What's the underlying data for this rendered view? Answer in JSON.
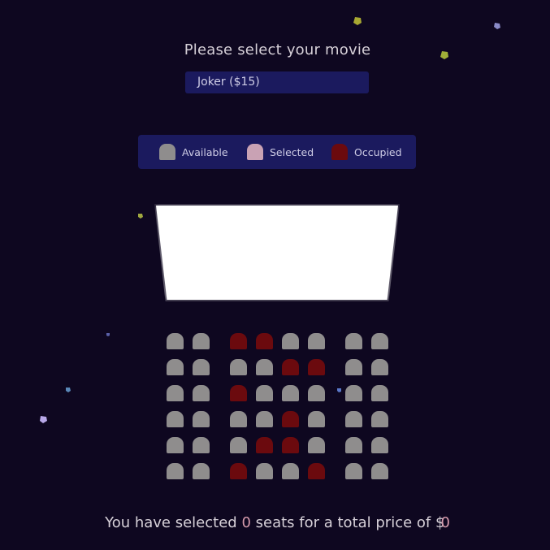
{
  "movie": {
    "label": "Please select your movie",
    "selected": "Joker ($15)"
  },
  "legend": [
    {
      "label": "Available",
      "state": "available"
    },
    {
      "label": "Selected",
      "state": "selected"
    },
    {
      "label": "Occupied",
      "state": "occupied"
    }
  ],
  "seats": [
    [
      "available",
      "available",
      "occupied",
      "occupied",
      "available",
      "available",
      "available",
      "available"
    ],
    [
      "available",
      "available",
      "available",
      "available",
      "occupied",
      "occupied",
      "available",
      "available"
    ],
    [
      "available",
      "available",
      "occupied",
      "available",
      "available",
      "available",
      "available",
      "available"
    ],
    [
      "available",
      "available",
      "available",
      "available",
      "occupied",
      "available",
      "available",
      "available"
    ],
    [
      "available",
      "available",
      "available",
      "occupied",
      "occupied",
      "available",
      "available",
      "available"
    ],
    [
      "available",
      "available",
      "occupied",
      "available",
      "available",
      "occupied",
      "available",
      "available"
    ]
  ],
  "summary": {
    "prefix": "You have selected",
    "count": "0",
    "middle": "seats for a total price of",
    "currency": "$",
    "total": "0"
  },
  "colors": {
    "background": "#0e0720",
    "panel": "#1b1a5e",
    "available": "#8f8d8d",
    "selected": "#c9a2b4",
    "occupied": "#6b0a0e",
    "highlight": "#d59aac"
  }
}
